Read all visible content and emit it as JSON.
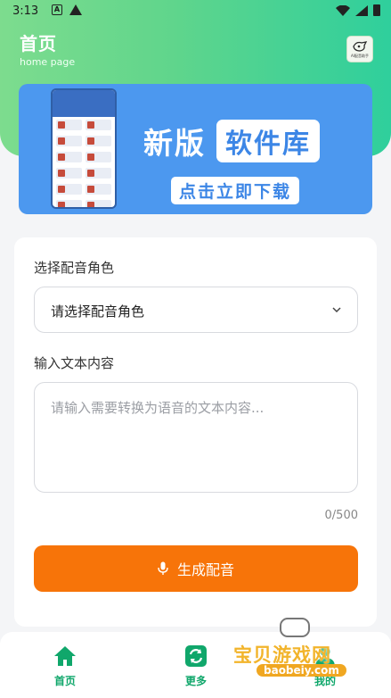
{
  "status_bar": {
    "time": "3:13"
  },
  "header": {
    "title": "首页",
    "subtitle": "home page",
    "logo_text": "AI配音助手"
  },
  "banner": {
    "title_part1": "新版",
    "title_part2": "软件库",
    "cta": "点击立即下载"
  },
  "form": {
    "role_label": "选择配音角色",
    "role_placeholder": "请选择配音角色",
    "text_label": "输入文本内容",
    "text_placeholder": "请输入需要转换为语音的文本内容...",
    "char_count": "0/500",
    "generate_button": "生成配音"
  },
  "tabbar": {
    "tabs": [
      {
        "label": "首页",
        "icon": "home-icon"
      },
      {
        "label": "更多",
        "icon": "refresh-icon"
      },
      {
        "label": "我的",
        "icon": "user-icon"
      }
    ]
  },
  "watermark": {
    "title": "宝贝游戏网",
    "site": "baobeiy.com"
  },
  "colors": {
    "header_start": "#7ddc8e",
    "header_end": "#2fcf9c",
    "banner_bg": "#4c98ef",
    "button_bg": "#f77409",
    "tab_active": "#10a76b"
  }
}
